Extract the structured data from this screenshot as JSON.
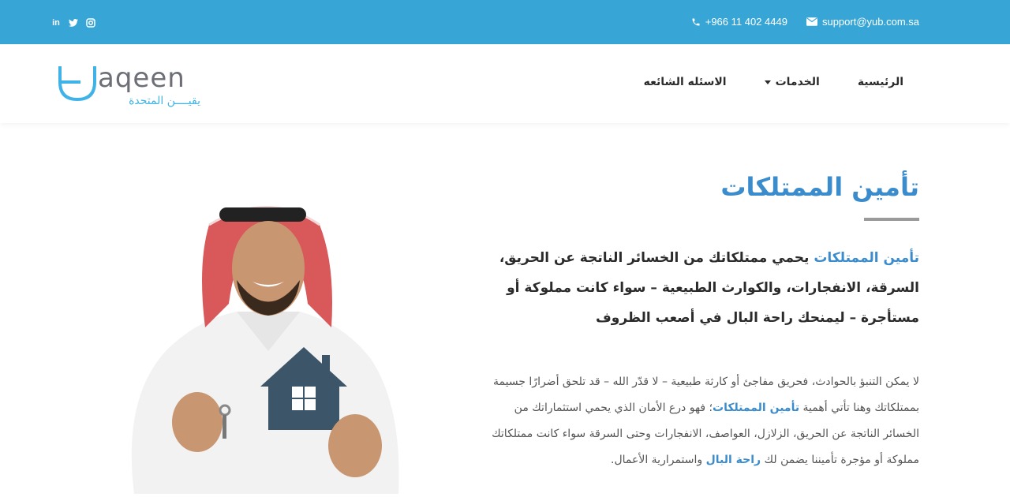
{
  "topbar": {
    "social": [
      {
        "icon": "linkedin-icon",
        "glyph": "in"
      },
      {
        "icon": "twitter-icon",
        "glyph": ""
      },
      {
        "icon": "instagram-icon",
        "glyph": ""
      }
    ],
    "phone": "+966 11 402 4449",
    "email": "support@yub.com.sa",
    "bg_color": "#37a6d6"
  },
  "header": {
    "logo_text": "yaqeen",
    "logo_subtext": "يقيــــن المتحدة",
    "nav": {
      "home": "الرئيسية",
      "services": "الخدمات",
      "faq": "الاسئله الشائعه"
    }
  },
  "main": {
    "title": "تأمين الممتلكات",
    "lead_highlight": "تأمين الممتلكات",
    "lead_text": " يحمي ممتلكاتك من الخسائر الناتجة عن الحريق، السرقة، الانفجارات، والكوارث الطبيعية – سواء كانت مملوكة أو مستأجرة – ليمنحك راحة البال في أصعب الظروف",
    "body_part1": "لا يمكن التنبؤ بالحوادث، فحريق مفاجئ أو كارثة طبيعية – لا قدّر الله – قد تلحق أضرارًا جسيمة بممتلكاتك وهنا تأتي أهمية ",
    "body_highlight1": "تأمين الممتلكات",
    "body_part2": "؛ فهو درع الأمان الذي يحمي استثماراتك من الخسائر الناتجة عن الحريق، الزلازل، العواصف، الانفجارات وحتى السرقة سواء كانت ممتلكاتك مملوكة أو مؤجرة تأميننا يضمن لك ",
    "body_highlight2": "راحة البال",
    "body_part3": " واستمرارية الأعمال.",
    "accent_color": "#3a8ccc"
  }
}
